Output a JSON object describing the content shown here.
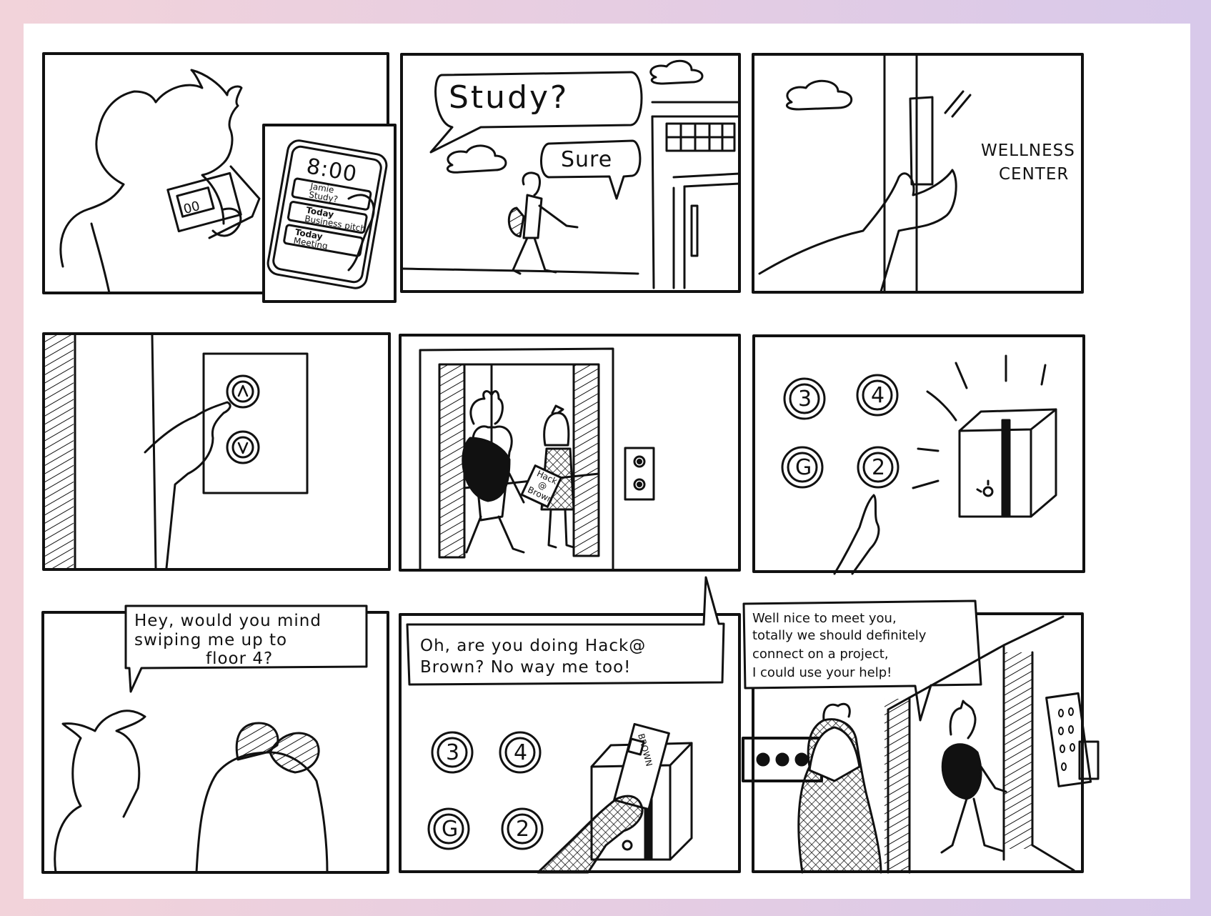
{
  "panel1": {
    "phone_time": "8:00",
    "notif1_title": "Jamie",
    "notif1_body": "Study?",
    "notif2_title": "Today",
    "notif2_body": "Business pitch",
    "notif3_title": "Today",
    "notif3_body": "Meeting",
    "card_digits": "00"
  },
  "panel2": {
    "bubble1": "Study?",
    "bubble2": "Sure"
  },
  "panel3": {
    "sign_line1": "WELLNESS",
    "sign_line2": "CENTER"
  },
  "panel5": {
    "bag_line1": "Hack",
    "bag_line2": "@",
    "bag_line3": "Brown"
  },
  "panel6": {
    "buttons": [
      "3",
      "4",
      "G",
      "2"
    ]
  },
  "panel7": {
    "caption_line1": "Hey, would you mind",
    "caption_line2": "swiping me up to",
    "caption_line3": "floor 4?"
  },
  "panel8": {
    "caption_line1": "Oh, are you doing Hack@",
    "caption_line2": "Brown? No way me too!",
    "buttons": [
      "3",
      "4",
      "G",
      "2"
    ],
    "card_text": "BROWN"
  },
  "panel9": {
    "caption_line1": "Well nice to meet you,",
    "caption_line2": "totally we should definitely",
    "caption_line3": "connect on a project,",
    "caption_line4": "I could use your help!"
  }
}
